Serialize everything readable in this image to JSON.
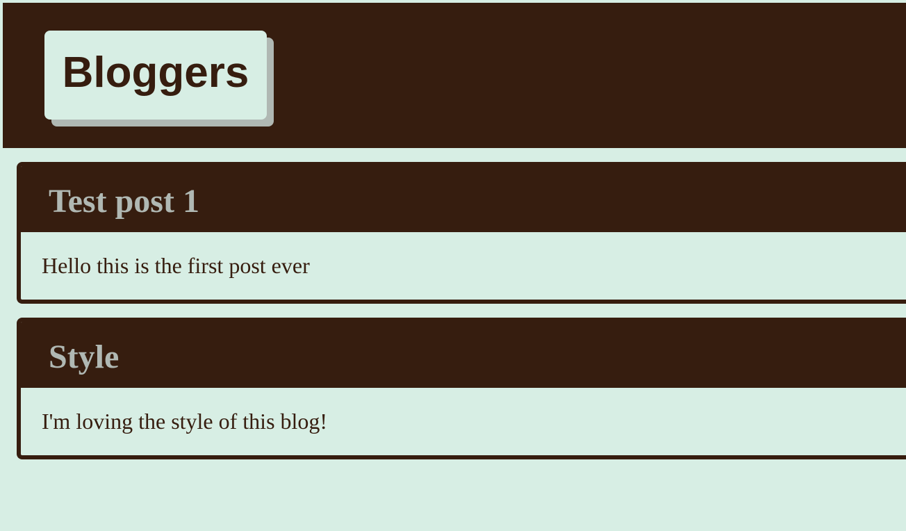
{
  "header": {
    "logo_text": "Bloggers"
  },
  "posts": [
    {
      "title": "Test post 1",
      "body": "Hello this is the first post ever"
    },
    {
      "title": "Style",
      "body": "I'm loving the style of this blog!"
    }
  ],
  "colors": {
    "background": "#d7eee4",
    "dark_brown": "#361d0f",
    "muted_gray": "#b0b8b3"
  }
}
